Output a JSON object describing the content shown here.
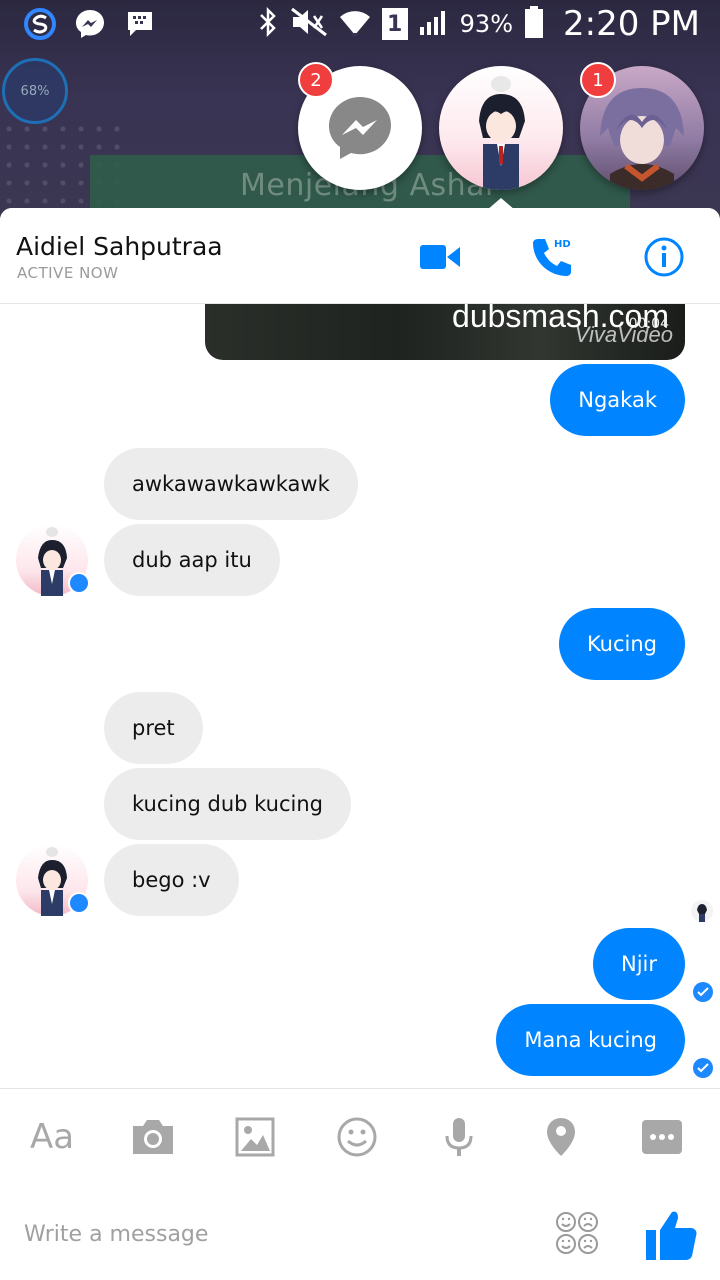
{
  "status_bar": {
    "battery_percent": "93%",
    "time": "2:20 PM",
    "sim": "1",
    "floating_widget_percent": "68%"
  },
  "wallpaper": {
    "text": "Menjelang Ashar"
  },
  "chat_heads": [
    {
      "id": "messenger",
      "badge": "2"
    },
    {
      "id": "aidiel",
      "badge": ""
    },
    {
      "id": "other",
      "badge": "1"
    }
  ],
  "header": {
    "name": "Aidiel Sahputraa",
    "status": "ACTIVE NOW",
    "hd_label": "HD"
  },
  "video": {
    "watermark": "dubsmash.com",
    "duration": "00:04",
    "brand": "VivaVideo"
  },
  "messages": [
    {
      "text": "Ngakak",
      "dir": "out"
    },
    {
      "text": "awkawawkawkawk",
      "dir": "in"
    },
    {
      "text": "dub aap itu",
      "dir": "in"
    },
    {
      "text": "Kucing",
      "dir": "out"
    },
    {
      "text": "pret",
      "dir": "in"
    },
    {
      "text": "kucing dub kucing",
      "dir": "in"
    },
    {
      "text": "bego :v",
      "dir": "in"
    },
    {
      "text": "Njir",
      "dir": "out"
    },
    {
      "text": "Mana kucing",
      "dir": "out"
    }
  ],
  "toolbar": {
    "text_label": "Aa",
    "icons": [
      "camera-icon",
      "gallery-icon",
      "emoji-icon",
      "microphone-icon",
      "location-icon",
      "more-icon"
    ]
  },
  "composer": {
    "placeholder": "Write a message"
  },
  "colors": {
    "brand": "#0084ff",
    "incoming": "#ececec",
    "badge": "#f03d3d"
  }
}
